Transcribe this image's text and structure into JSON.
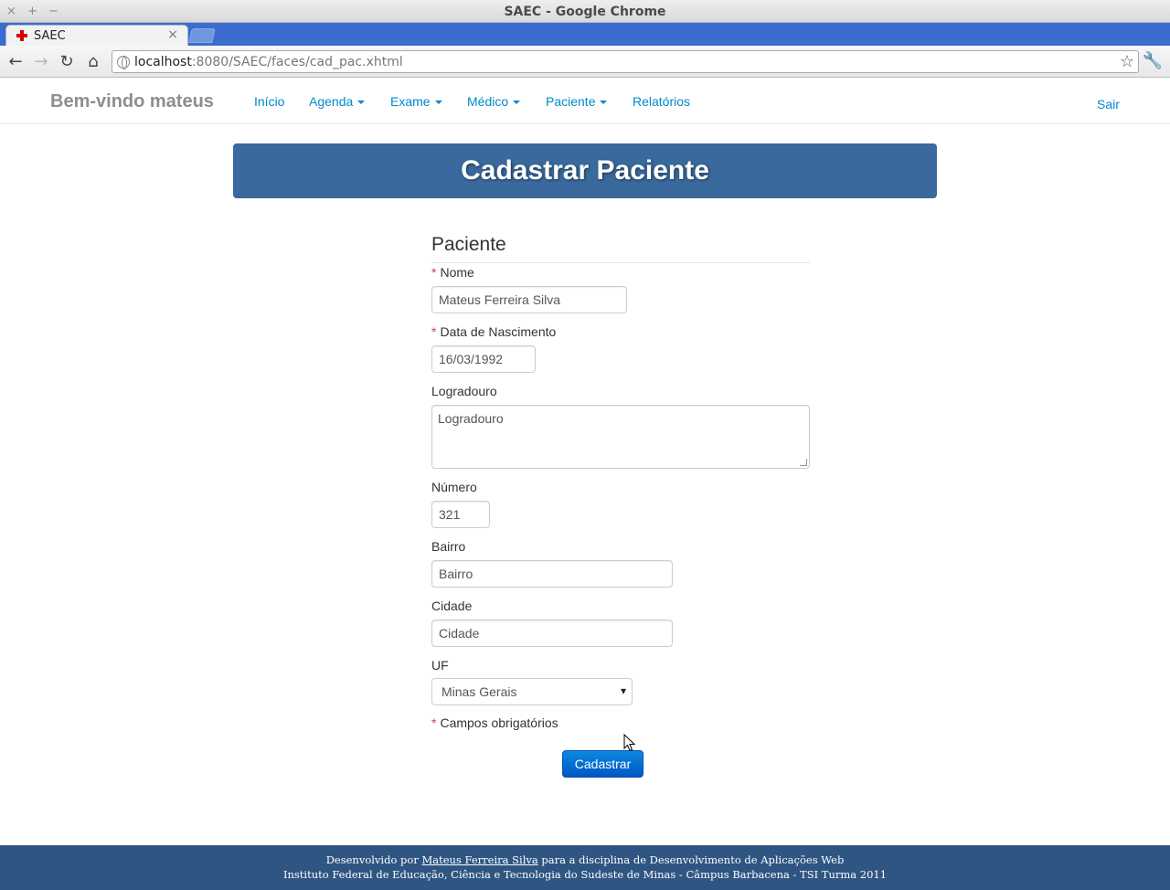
{
  "window": {
    "title": "SAEC - Google Chrome",
    "controls": [
      "×",
      "+",
      "−"
    ]
  },
  "tab": {
    "title": "SAEC",
    "close": "×"
  },
  "toolbar": {
    "url_host": "localhost",
    "url_rest": ":8080/SAEC/faces/cad_pac.xhtml",
    "back": "←",
    "forward": "→",
    "reload": "↻",
    "home": "⌂",
    "star": "☆",
    "wrench": "🔧"
  },
  "navbar": {
    "brand": "Bem-vindo mateus",
    "items": [
      {
        "label": "Início",
        "dropdown": false
      },
      {
        "label": "Agenda",
        "dropdown": true
      },
      {
        "label": "Exame",
        "dropdown": true
      },
      {
        "label": "Médico",
        "dropdown": true
      },
      {
        "label": "Paciente",
        "dropdown": true
      },
      {
        "label": "Relatórios",
        "dropdown": false
      }
    ],
    "logout": "Sair"
  },
  "header": {
    "title": "Cadastrar Paciente"
  },
  "form": {
    "legend": "Paciente",
    "required_mark": "*",
    "fields": {
      "nome": {
        "label": "Nome",
        "value": "Mateus Ferreira Silva",
        "required": true
      },
      "nascimento": {
        "label": "Data de Nascimento",
        "value": "16/03/1992",
        "required": true
      },
      "logradouro": {
        "label": "Logradouro",
        "placeholder": "Logradouro"
      },
      "numero": {
        "label": "Número",
        "value": "321"
      },
      "bairro": {
        "label": "Bairro",
        "placeholder": "Bairro"
      },
      "cidade": {
        "label": "Cidade",
        "placeholder": "Cidade"
      },
      "uf": {
        "label": "UF",
        "selected": "Minas Gerais",
        "arrow": "▾"
      }
    },
    "required_note": "Campos obrigatórios",
    "submit": "Cadastrar"
  },
  "footer": {
    "line1_prefix": "Desenvolvido por",
    "author": "Mateus Ferreira Silva",
    "line1_suffix": "para a disciplina de Desenvolvimento de Aplicações Web",
    "line2": "Instituto Federal de Educação, Ciência e Tecnologia do Sudeste de Minas - Câmpus Barbacena - TSI Turma 2011"
  },
  "colors": {
    "tabstrip": "#3b6ccf",
    "link": "#0088cc",
    "banner": "#3a6a9d",
    "footer": "#2f5583",
    "required": "#b94a48",
    "button": "#0a70d8"
  }
}
